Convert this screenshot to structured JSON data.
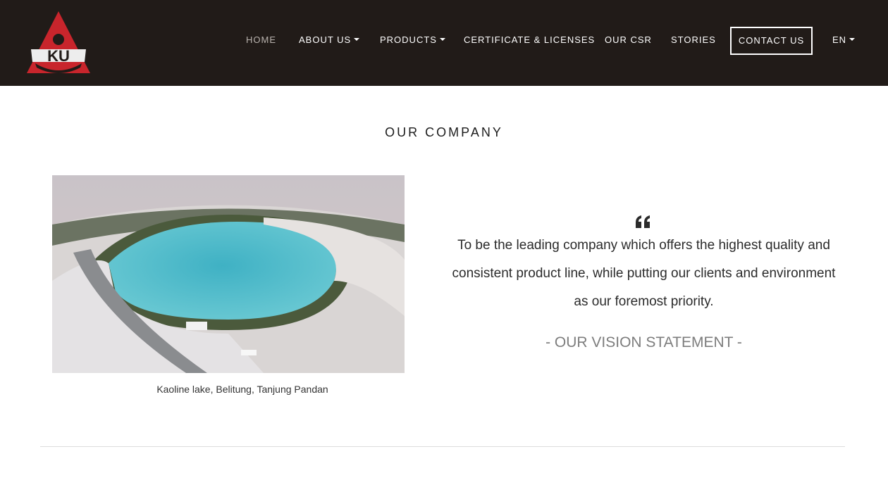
{
  "brand": {
    "logo_text": "KU",
    "logo_icon": "ku-triangle-logo",
    "brand_color": "#c8252c"
  },
  "nav": {
    "home": "HOME",
    "about": "ABOUT US",
    "products": "PRODUCTS",
    "certificates": "CERTIFICATE & LICENSES",
    "csr": "OUR CSR",
    "stories": "STORIES",
    "contact": "CONTACT US",
    "language": "EN"
  },
  "company": {
    "title": "OUR COMPANY",
    "image_caption": "Kaoline lake, Belitung, Tanjung Pandan",
    "quote_icon": "quote-icon",
    "vision_text": "To be the leading company which offers the highest quality and consistent product line, while putting our clients and environment as our foremost priority.",
    "vision_label": "- OUR VISION STATEMENT -"
  },
  "colors": {
    "navbar_bg": "#211b18",
    "lake": "#49b9c7"
  }
}
